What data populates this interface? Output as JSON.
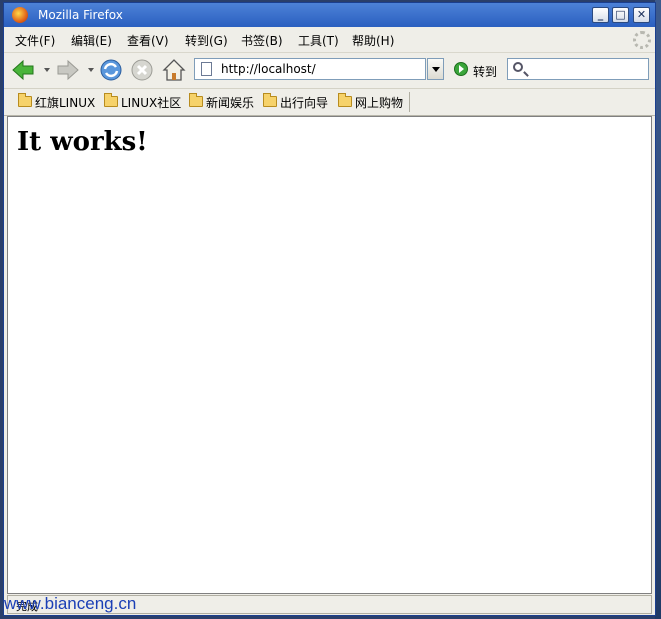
{
  "window": {
    "title": "Mozilla Firefox"
  },
  "menu": [
    "文件(F)",
    "编辑(E)",
    "查看(V)",
    "转到(G)",
    "书签(B)",
    "工具(T)",
    "帮助(H)"
  ],
  "nav": {
    "url": "http://localhost/",
    "go_label": "转到",
    "search_value": ""
  },
  "bookmarks": [
    "红旗LINUX",
    "LINUX社区",
    "新闻娱乐",
    "出行向导",
    "网上购物"
  ],
  "content": {
    "heading": "It works!"
  },
  "status": {
    "text": "完成"
  },
  "watermark": "www.bianceng.cn",
  "colors": {
    "titlebar": "#2a5fc0",
    "link_blue": "#1b3fb6"
  }
}
